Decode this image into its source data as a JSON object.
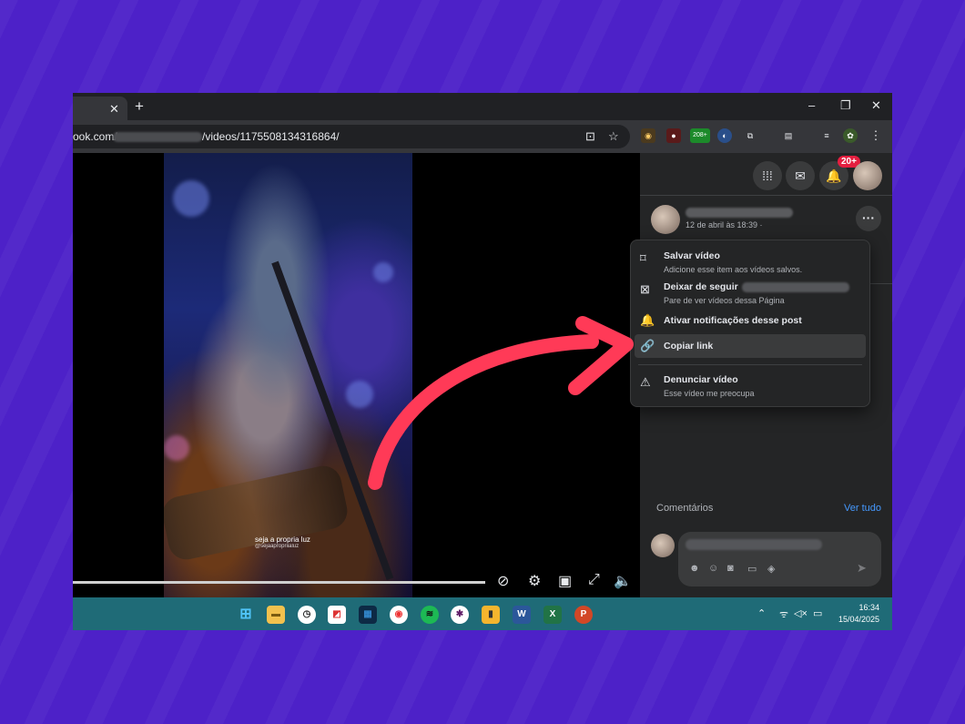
{
  "browser": {
    "tab_close": "✕",
    "new_tab": "+",
    "minimize": "–",
    "restore": "❐",
    "close": "✕",
    "url_prefix": "ook.com/",
    "url_suffix": "/videos/1175508134316864/",
    "extension_badge": "208+"
  },
  "video": {
    "watermark_title": "seja a propria luz",
    "watermark_handle": "@sejaapropriialuz"
  },
  "facebook": {
    "notifications_badge": "20+",
    "post_date": "12 de abril às 18:39 ·",
    "comments_label": "Comentários",
    "see_all": "Ver tudo"
  },
  "menu": {
    "items": [
      {
        "title": "Salvar vídeo",
        "subtitle": "Adicione esse item aos vídeos salvos.",
        "icon": "bookmark-icon"
      },
      {
        "title": "Deixar de seguir",
        "subtitle": "Pare de ver vídeos dessa Página",
        "icon": "unfollow-icon"
      },
      {
        "title": "Ativar notificações desse post",
        "subtitle": "",
        "icon": "bell-icon"
      },
      {
        "title": "Copiar link",
        "subtitle": "",
        "icon": "link-icon"
      },
      {
        "title": "Denunciar vídeo",
        "subtitle": "Esse vídeo me preocupa",
        "icon": "report-icon"
      }
    ]
  },
  "taskbar": {
    "time": "16:34",
    "date": "15/04/2025"
  },
  "colors": {
    "background": "#4d21c8",
    "arrow": "#ff3a57",
    "taskbar": "#1f6b77",
    "link_blue": "#4599ff"
  }
}
